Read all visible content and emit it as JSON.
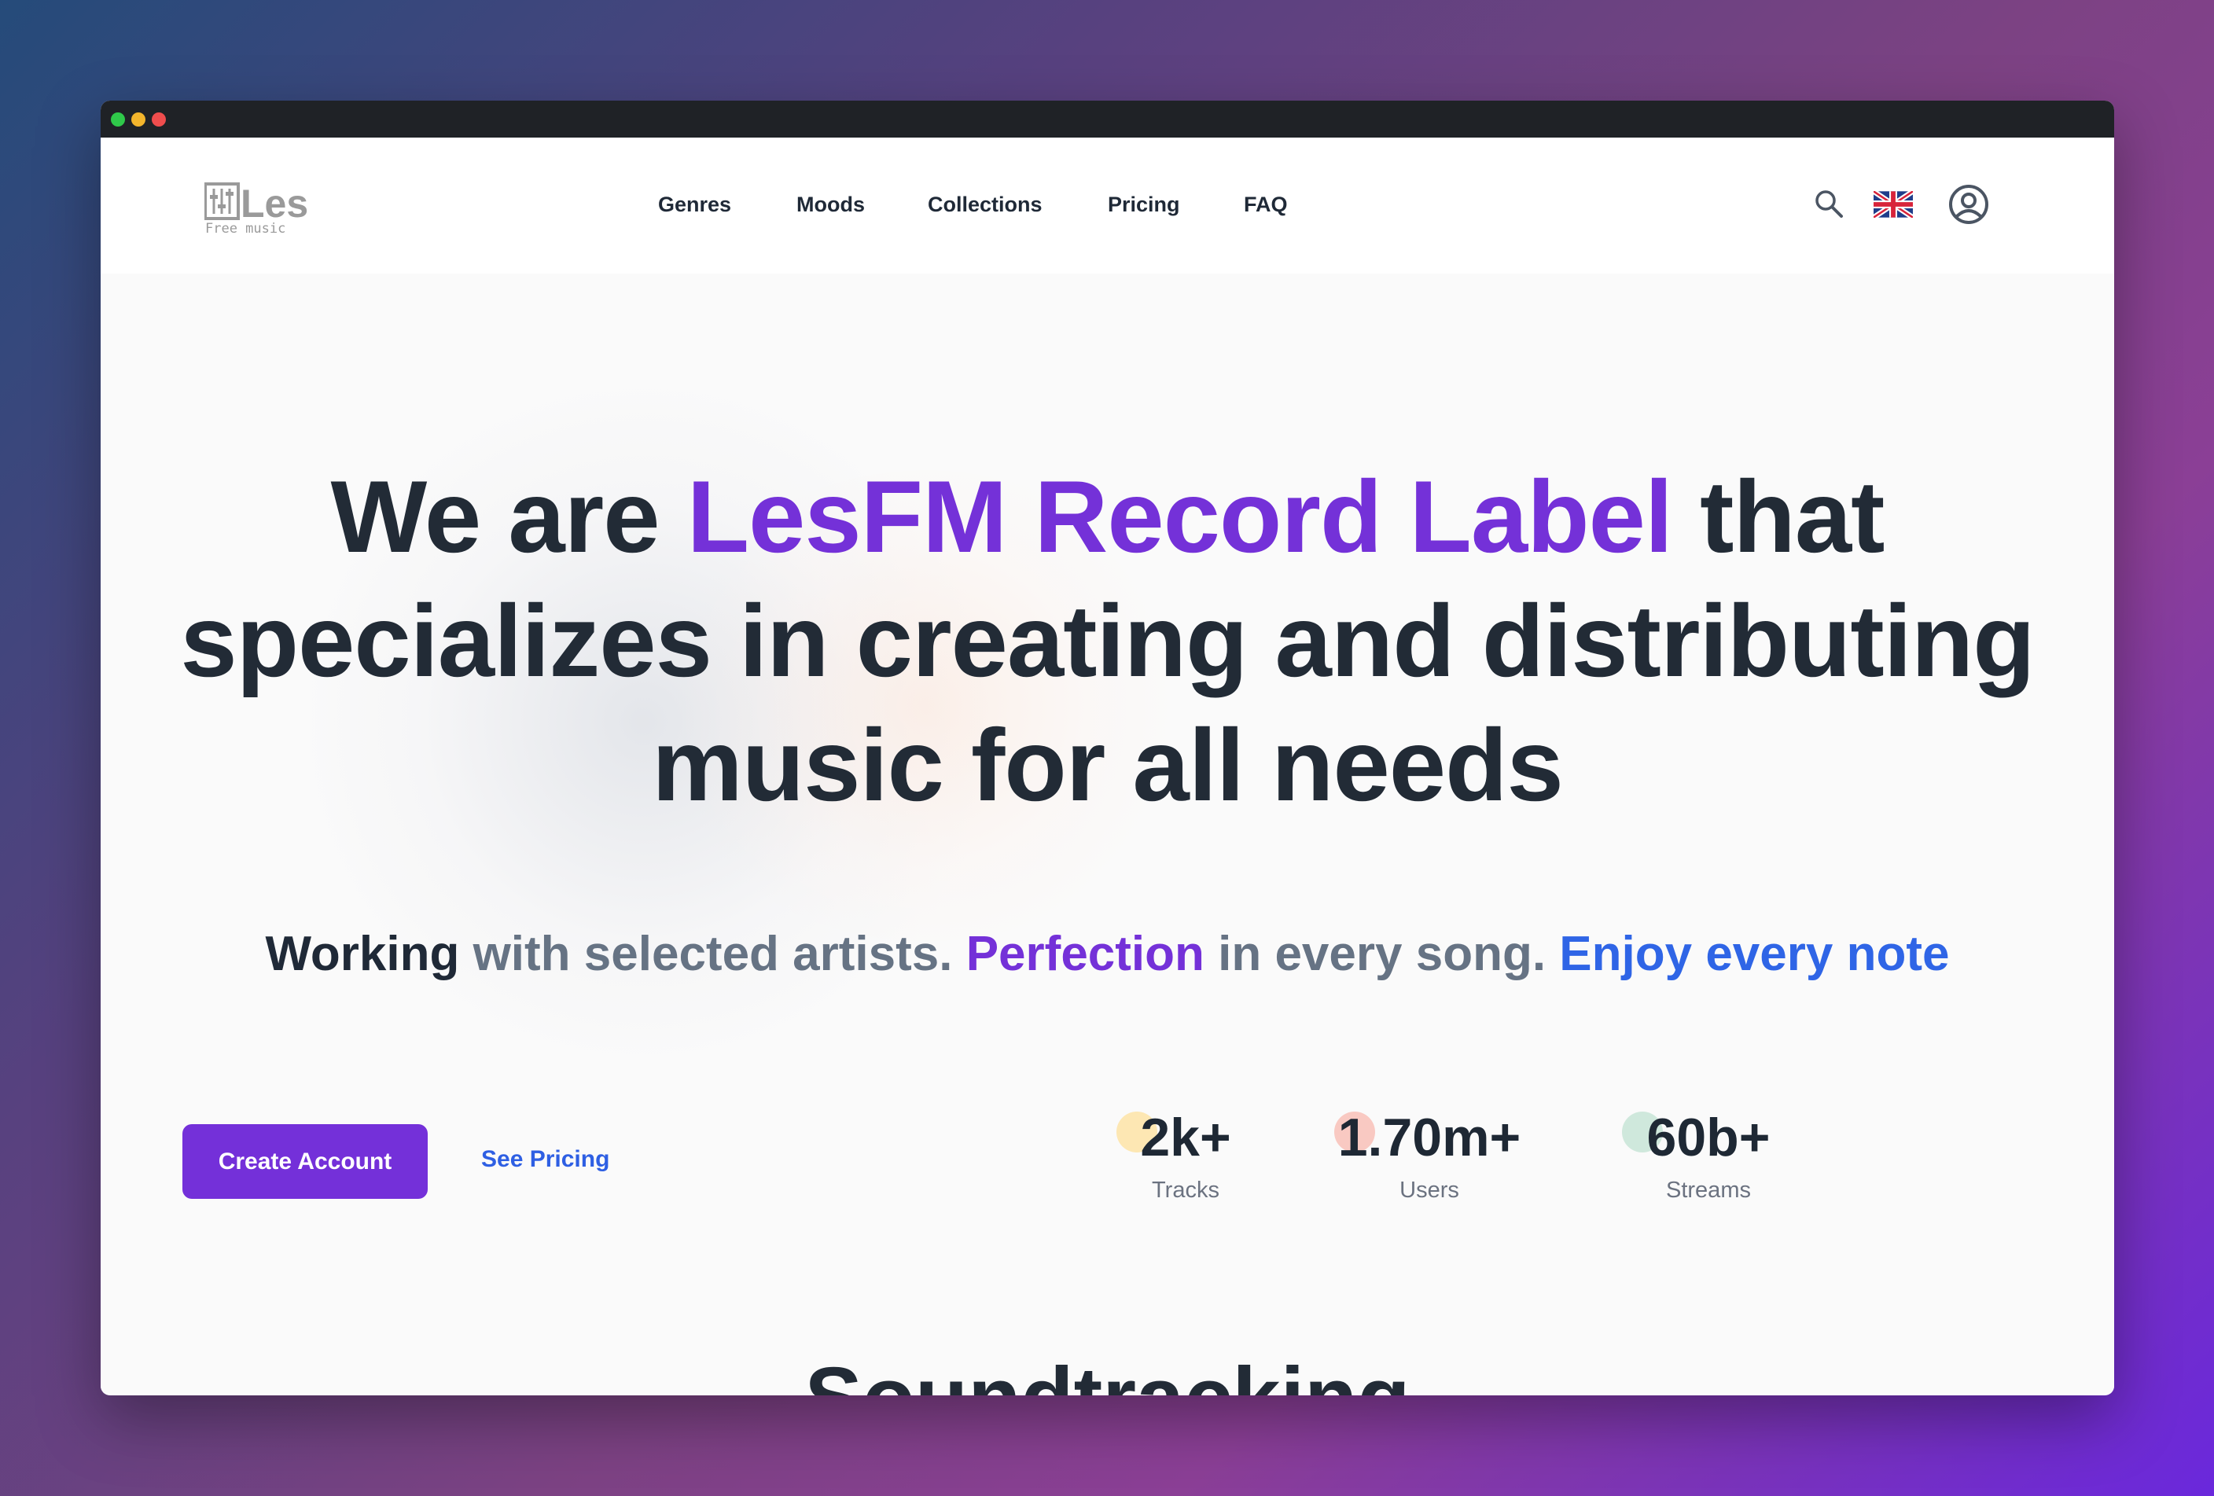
{
  "window": {
    "traffic_lights": [
      "green",
      "yellow",
      "red"
    ]
  },
  "brand": {
    "logo_text": "Les",
    "logo_subtext": "Free music"
  },
  "nav": {
    "links": [
      "Genres",
      "Moods",
      "Collections",
      "Pricing",
      "FAQ"
    ],
    "icons": [
      "search-icon",
      "uk-flag-icon",
      "user-account-icon"
    ]
  },
  "hero": {
    "headline_part1": "We are ",
    "headline_accent": "LesFM Record Label",
    "headline_part2": " that specializes in creating and distributing music for all needs",
    "tagline": {
      "working": "Working",
      "with_selected": " with selected artists. ",
      "perfection": "Perfection",
      "in_every_song": " in every song. ",
      "enjoy": "Enjoy every note"
    },
    "primary_button": "Create Account",
    "secondary_link": "See Pricing",
    "stats": [
      {
        "value": "2k+",
        "label": "Tracks",
        "color": "#fde7b3"
      },
      {
        "value": "1.70m+",
        "label": "Users",
        "color": "#f9c9c2"
      },
      {
        "value": "60b+",
        "label": "Streams",
        "color": "#cfe8dc"
      }
    ]
  },
  "next_section": {
    "heading": "Soundtracking"
  },
  "colors": {
    "accent_purple": "#7431d8",
    "accent_blue": "#2f65e6",
    "text_dark": "#222b36"
  }
}
